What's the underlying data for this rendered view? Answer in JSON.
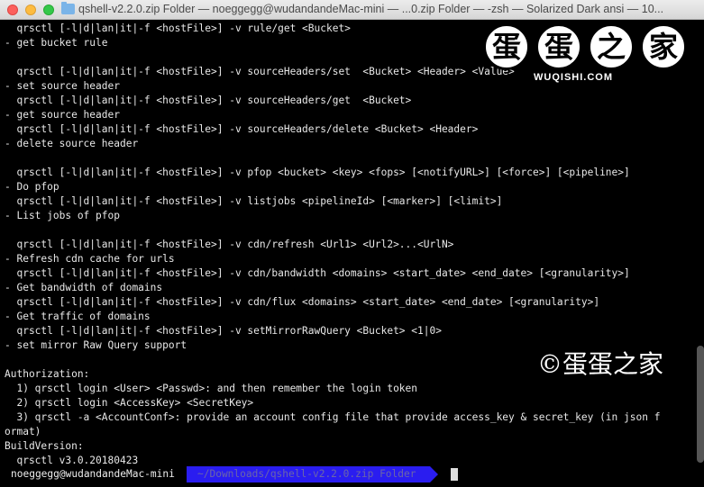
{
  "window": {
    "title": "qshell-v2.2.0.zip Folder — noeggegg@wudandandeMac-mini — ...0.zip Folder — -zsh — Solarized Dark ansi — 10..."
  },
  "terminal": {
    "lines": [
      "  qrsctl [-l|d|lan|it|-f <hostFile>] -v rule/get <Bucket>",
      "- get bucket rule",
      "",
      "  qrsctl [-l|d|lan|it|-f <hostFile>] -v sourceHeaders/set  <Bucket> <Header> <Value>",
      "- set source header",
      "  qrsctl [-l|d|lan|it|-f <hostFile>] -v sourceHeaders/get  <Bucket>",
      "- get source header",
      "  qrsctl [-l|d|lan|it|-f <hostFile>] -v sourceHeaders/delete <Bucket> <Header>",
      "- delete source header",
      "",
      "  qrsctl [-l|d|lan|it|-f <hostFile>] -v pfop <bucket> <key> <fops> [<notifyURL>] [<force>] [<pipeline>]",
      "- Do pfop",
      "  qrsctl [-l|d|lan|it|-f <hostFile>] -v listjobs <pipelineId> [<marker>] [<limit>]",
      "- List jobs of pfop",
      "",
      "  qrsctl [-l|d|lan|it|-f <hostFile>] -v cdn/refresh <Url1> <Url2>...<UrlN>",
      "- Refresh cdn cache for urls",
      "  qrsctl [-l|d|lan|it|-f <hostFile>] -v cdn/bandwidth <domains> <start_date> <end_date> [<granularity>]",
      "- Get bandwidth of domains",
      "  qrsctl [-l|d|lan|it|-f <hostFile>] -v cdn/flux <domains> <start_date> <end_date> [<granularity>]",
      "- Get traffic of domains",
      "  qrsctl [-l|d|lan|it|-f <hostFile>] -v setMirrorRawQuery <Bucket> <1|0>",
      "- set mirror Raw Query support",
      "",
      "Authorization:",
      "  1) qrsctl login <User> <Passwd>: and then remember the login token",
      "  2) qrsctl login <AccessKey> <SecretKey>",
      "  3) qrsctl -a <AccountConf>: provide an account config file that provide access_key & secret_key (in json f",
      "ormat)",
      "BuildVersion:",
      "  qrsctl v3.0.20180423"
    ],
    "prompt": {
      "user_host": "noeggegg@wudandandeMac-mini",
      "path": "~/Downloads/qshell-v2.2.0.zip Folder"
    }
  },
  "watermark": {
    "logo_chars": [
      "蛋",
      "蛋",
      "之",
      "家"
    ],
    "logo_sub": "WUQISHI.COM",
    "copyright": "©蛋蛋之家"
  },
  "colors": {
    "terminal_bg": "#000000",
    "terminal_fg": "#e8e8e8",
    "path_segment": "#2a1df0"
  }
}
